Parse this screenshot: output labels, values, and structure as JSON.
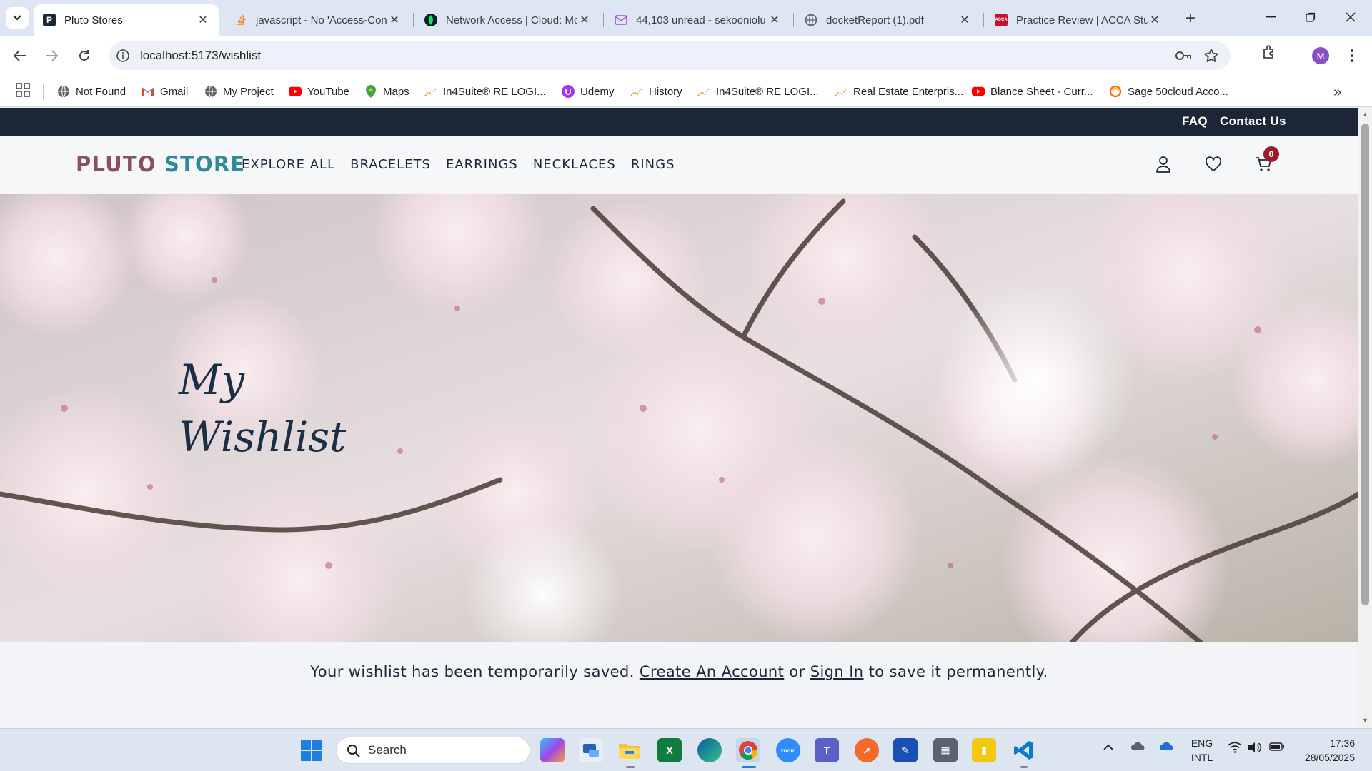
{
  "browser": {
    "tabs": [
      {
        "title": "Pluto Stores",
        "favicon": "P",
        "active": true
      },
      {
        "title": "javascript - No 'Access-Control",
        "favicon": "so"
      },
      {
        "title": "Network Access | Cloud: MongoDB",
        "favicon": "leaf"
      },
      {
        "title": "44,103 unread - sekooniolu",
        "favicon": "mail"
      },
      {
        "title": "docketReport (1).pdf",
        "favicon": "globe"
      },
      {
        "title": "Practice Review | ACCA Study",
        "favicon": "ACCA"
      }
    ],
    "url": "localhost:5173/wishlist",
    "profile_initial": "M",
    "bookmarks": [
      {
        "label": "Not Found",
        "icon": "globe-icon"
      },
      {
        "label": "Gmail",
        "icon": "gmail-icon"
      },
      {
        "label": "My Project",
        "icon": "globe-icon"
      },
      {
        "label": "YouTube",
        "icon": "youtube-icon"
      },
      {
        "label": "Maps",
        "icon": "maps-icon"
      },
      {
        "label": "In4Suite® RE LOGI...",
        "icon": "chart-icon"
      },
      {
        "label": "Udemy",
        "icon": "udemy-icon"
      },
      {
        "label": "History",
        "icon": "chart-icon"
      },
      {
        "label": "In4Suite® RE LOGI...",
        "icon": "chart-icon"
      },
      {
        "label": "Real Estate Enterpris...",
        "icon": "chart-icon"
      },
      {
        "label": "Blance Sheet - Curr...",
        "icon": "youtube-icon"
      },
      {
        "label": "Sage 50cloud Acco...",
        "icon": "sage-icon"
      }
    ]
  },
  "site": {
    "top_links": {
      "faq": "FAQ",
      "contact": "Contact Us"
    },
    "logo": {
      "part1": "PLUTO ",
      "part2": "STORE"
    },
    "nav": [
      "EXPLORE ALL",
      "BRACELETS",
      "EARRINGS",
      "NECKLACES",
      "RINGS"
    ],
    "cart_count": "0",
    "hero_title": "My\nWishlist",
    "notice": {
      "before": "Your wishlist has been temporarily saved. ",
      "create_link": "Create An Account",
      "middle": " or ",
      "signin_link": "Sign In",
      "after": " to save it permanently."
    },
    "colors": {
      "topstrip": "#1b2637",
      "logo_pluto": "#8a5060",
      "logo_store": "#2e8a96",
      "badge": "#9b1c2c"
    }
  },
  "taskbar": {
    "search_placeholder": "Search",
    "lang_line1": "ENG",
    "lang_line2": "INTL",
    "time": "17:36",
    "date": "28/05/2025"
  }
}
